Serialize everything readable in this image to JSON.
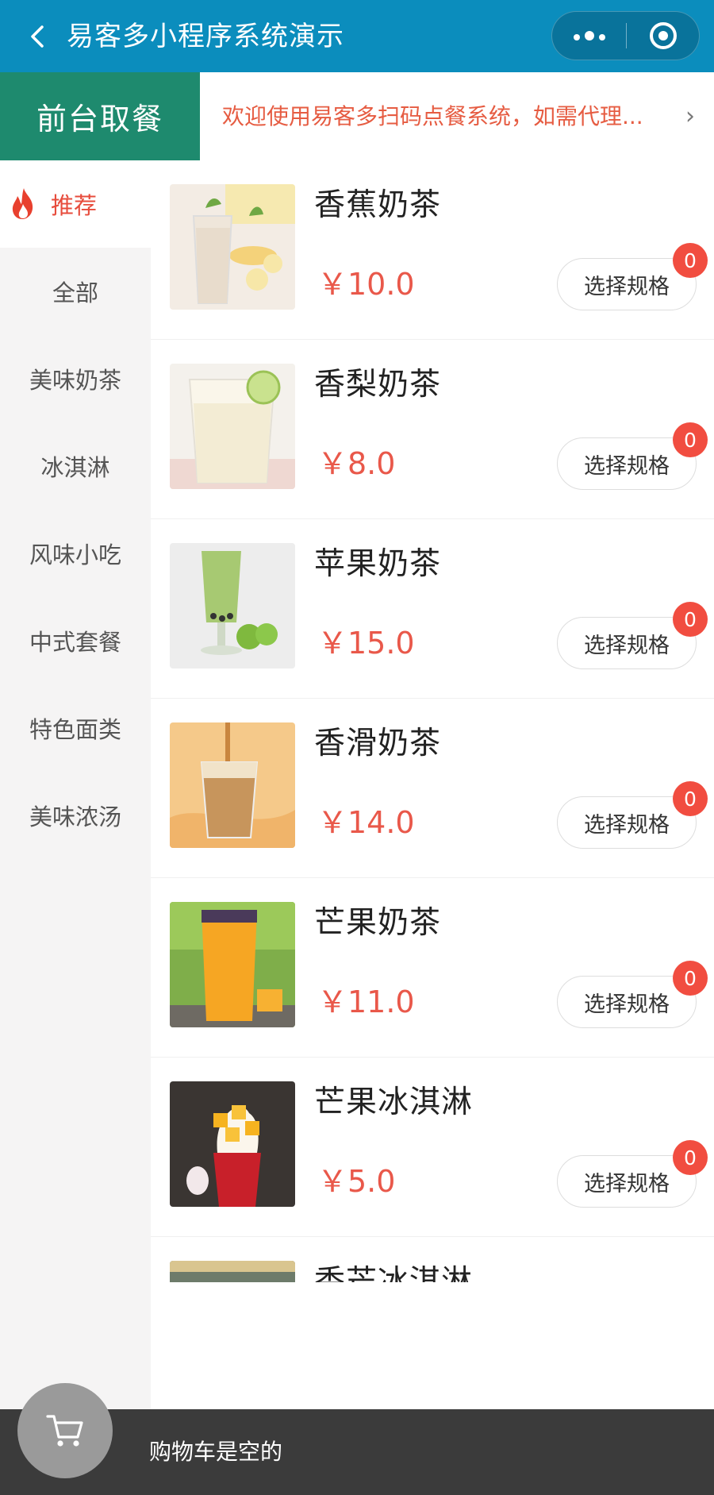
{
  "header": {
    "title": "易客多小程序系统演示",
    "back_icon": "back-arrow-icon",
    "menu_icon": "more-dots-icon",
    "close_icon": "target-circle-icon",
    "bg_color": "#0b8dbd"
  },
  "topbar": {
    "mode_label": "前台取餐",
    "notice": "欢迎使用易客多扫码点餐系统，如需代理...",
    "mode_color": "#1e8a6e",
    "notice_color": "#e65c42"
  },
  "sidebar": {
    "items": [
      {
        "label": "推荐",
        "active": true,
        "icon": "flame-icon"
      },
      {
        "label": "全部"
      },
      {
        "label": "美味奶茶"
      },
      {
        "label": "冰淇淋"
      },
      {
        "label": "风味小吃"
      },
      {
        "label": "中式套餐"
      },
      {
        "label": "特色面类"
      },
      {
        "label": "美味浓汤"
      }
    ]
  },
  "products": [
    {
      "name": "香蕉奶茶",
      "price": "￥10.0",
      "spec_label": "选择规格",
      "count": "0"
    },
    {
      "name": "香梨奶茶",
      "price": "￥8.0",
      "spec_label": "选择规格",
      "count": "0"
    },
    {
      "name": "苹果奶茶",
      "price": "￥15.0",
      "spec_label": "选择规格",
      "count": "0"
    },
    {
      "name": "香滑奶茶",
      "price": "￥14.0",
      "spec_label": "选择规格",
      "count": "0"
    },
    {
      "name": "芒果奶茶",
      "price": "￥11.0",
      "spec_label": "选择规格",
      "count": "0"
    },
    {
      "name": "芒果冰淇淋",
      "price": "￥5.0",
      "spec_label": "选择规格",
      "count": "0"
    },
    {
      "name": "香芒冰淇淋"
    }
  ],
  "cart": {
    "empty_text": "购物车是空的",
    "icon": "shopping-cart-icon",
    "bar_color": "#3b3b3b"
  },
  "colors": {
    "price": "#e9584a",
    "badge": "#f14d40",
    "accent_red": "#e74c3c"
  }
}
